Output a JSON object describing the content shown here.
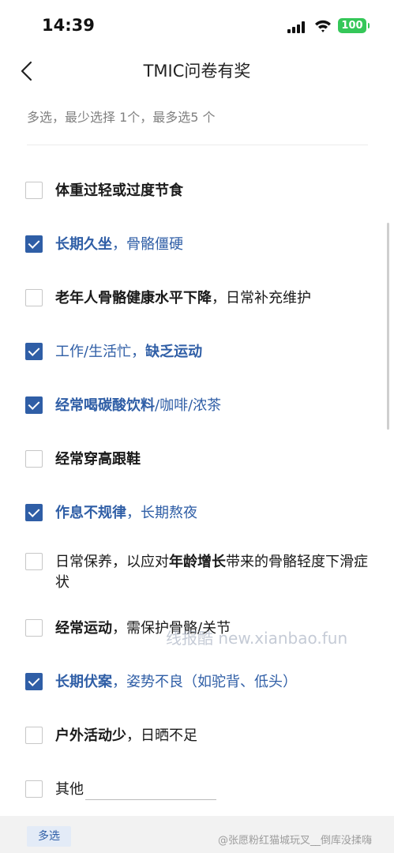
{
  "status_bar": {
    "time": "14:39",
    "battery": "100"
  },
  "nav": {
    "title": "TMIC问卷有奖"
  },
  "question": {
    "hint": "多选，最少选择 1个，最多选5 个"
  },
  "options": [
    {
      "parts": [
        {
          "t": "体重过轻或过度节食",
          "b": true
        }
      ],
      "checked": false
    },
    {
      "parts": [
        {
          "t": "长期久坐",
          "b": true
        },
        {
          "t": "，骨骼僵硬",
          "b": false
        }
      ],
      "checked": true
    },
    {
      "parts": [
        {
          "t": "老年人骨骼健康水平下降",
          "b": true
        },
        {
          "t": "，日常补充维护",
          "b": false
        }
      ],
      "checked": false
    },
    {
      "parts": [
        {
          "t": "工作/生活忙，",
          "b": false
        },
        {
          "t": "缺乏运动",
          "b": true
        }
      ],
      "checked": true
    },
    {
      "parts": [
        {
          "t": "经常喝碳酸饮料",
          "b": true
        },
        {
          "t": "/咖啡/浓茶",
          "b": false
        }
      ],
      "checked": true
    },
    {
      "parts": [
        {
          "t": "经常穿高跟鞋",
          "b": true
        }
      ],
      "checked": false
    },
    {
      "parts": [
        {
          "t": "作息不规律",
          "b": true
        },
        {
          "t": "，长期熬夜",
          "b": false
        }
      ],
      "checked": true
    },
    {
      "parts": [
        {
          "t": "日常保养，以应对",
          "b": false
        },
        {
          "t": "年龄增长",
          "b": true
        },
        {
          "t": "带来的骨骼轻度下滑症状",
          "b": false
        }
      ],
      "checked": false
    },
    {
      "parts": [
        {
          "t": "经常运动",
          "b": true
        },
        {
          "t": "，需保护骨骼/关节",
          "b": false
        }
      ],
      "checked": false
    },
    {
      "parts": [
        {
          "t": "长期伏案",
          "b": true
        },
        {
          "t": "，姿势不良（如驼背、低头）",
          "b": false
        }
      ],
      "checked": true
    },
    {
      "parts": [
        {
          "t": "户外活动少",
          "b": true
        },
        {
          "t": "，日晒不足",
          "b": false
        }
      ],
      "checked": false
    },
    {
      "parts": [
        {
          "t": "其他",
          "b": false
        }
      ],
      "checked": false,
      "has_input": true
    }
  ],
  "watermark": "线报酷 new.xianbao.fun",
  "footer": {
    "tag": "多选",
    "weibo_mark": "@张愿粉红猫城玩叉__倒库没揉嗨"
  },
  "colors": {
    "accent": "#2f5ea6",
    "battery": "#35c759"
  }
}
